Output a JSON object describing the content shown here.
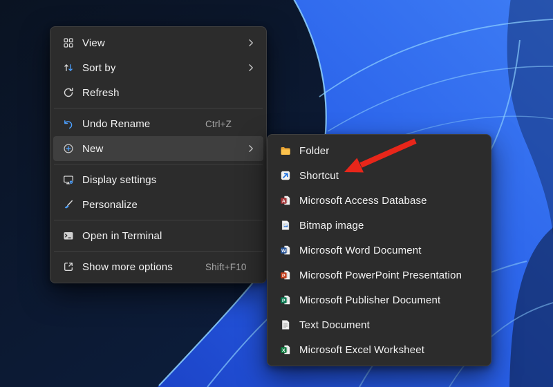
{
  "colors": {
    "accent": "#4ca0ff",
    "menu_bg": "#2c2c2c",
    "menu_highlight": "#3f3f3f",
    "menu_text": "#f2f2f2",
    "shortcut_text": "#a6a6a6",
    "icon_gray": "#d9d9d9",
    "folder_yellow": "#fcc24c",
    "shortcut_arrow_blue": "#1a6fe0",
    "access_red": "#a4373a",
    "word_blue": "#2b579a",
    "powerpoint_red": "#c43e1c",
    "publisher_green": "#0a7a52",
    "excel_green": "#107c41",
    "annotation_red": "#e8261a",
    "wallpaper_blue": "#2a62ea",
    "wallpaper_dark": "#0b1526"
  },
  "context_menu": {
    "items": [
      {
        "label": "View",
        "icon": "grid-icon",
        "has_submenu": true
      },
      {
        "label": "Sort by",
        "icon": "sort-icon",
        "has_submenu": true
      },
      {
        "label": "Refresh",
        "icon": "refresh-icon"
      },
      {
        "type": "separator"
      },
      {
        "label": "Undo Rename",
        "icon": "undo-icon",
        "shortcut": "Ctrl+Z"
      },
      {
        "label": "New",
        "icon": "new-plus-icon",
        "has_submenu": true,
        "highlighted": true
      },
      {
        "type": "separator"
      },
      {
        "label": "Display settings",
        "icon": "display-settings-icon"
      },
      {
        "label": "Personalize",
        "icon": "personalize-icon"
      },
      {
        "type": "separator"
      },
      {
        "label": "Open in Terminal",
        "icon": "terminal-icon"
      },
      {
        "type": "separator"
      },
      {
        "label": "Show more options",
        "icon": "show-more-icon",
        "shortcut": "Shift+F10"
      }
    ]
  },
  "submenu": {
    "items": [
      {
        "label": "Folder",
        "icon": "folder-icon"
      },
      {
        "label": "Shortcut",
        "icon": "shortcut-icon",
        "annotated": true
      },
      {
        "label": "Microsoft Access Database",
        "icon": "access-icon"
      },
      {
        "label": "Bitmap image",
        "icon": "bitmap-icon"
      },
      {
        "label": "Microsoft Word Document",
        "icon": "word-icon"
      },
      {
        "label": "Microsoft PowerPoint Presentation",
        "icon": "powerpoint-icon"
      },
      {
        "label": "Microsoft Publisher Document",
        "icon": "publisher-icon"
      },
      {
        "label": "Text Document",
        "icon": "text-icon"
      },
      {
        "label": "Microsoft Excel Worksheet",
        "icon": "excel-icon"
      }
    ]
  },
  "annotation": {
    "type": "arrow",
    "points_to": "Shortcut",
    "color": "#e8261a"
  }
}
